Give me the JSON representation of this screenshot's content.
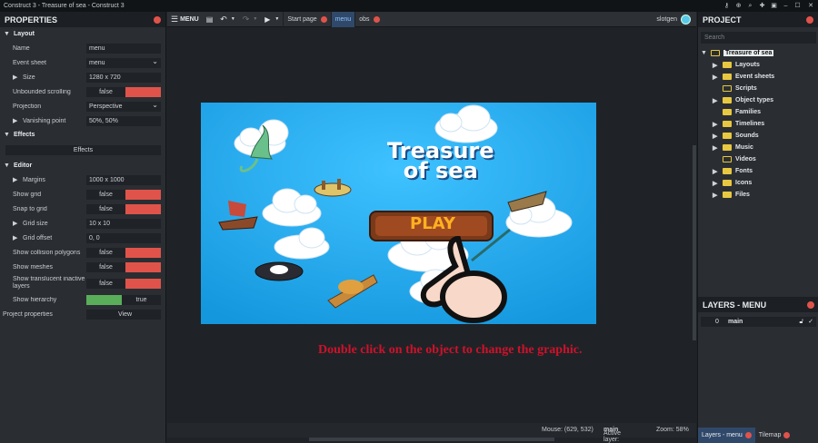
{
  "window": {
    "title": "Construct 3 - Treasure of sea - Construct 3"
  },
  "properties": {
    "title": "PROPERTIES",
    "sections": {
      "layout": "Layout",
      "effects": "Effects",
      "editor": "Editor"
    },
    "rows": {
      "name_label": "Name",
      "name_value": "menu",
      "eventsheet_label": "Event sheet",
      "eventsheet_value": "menu",
      "size_label": "Size",
      "size_value": "1280 x 720",
      "unbounded_label": "Unbounded scrolling",
      "unbounded_value": "false",
      "projection_label": "Projection",
      "projection_value": "Perspective",
      "vanishing_label": "Vanishing point",
      "vanishing_value": "50%, 50%",
      "effects_button": "Effects",
      "margins_label": "Margins",
      "margins_value": "1000 x 1000",
      "showgrid_label": "Show grid",
      "showgrid_value": "false",
      "snap_label": "Snap to grid",
      "snap_value": "false",
      "gridsize_label": "Grid size",
      "gridsize_value": "10 x 10",
      "gridoffset_label": "Grid offset",
      "gridoffset_value": "0, 0",
      "collision_label": "Show collision polygons",
      "collision_value": "false",
      "meshes_label": "Show meshes",
      "meshes_value": "false",
      "translucent_label": "Show translucent inactive layers",
      "translucent_value": "false",
      "hierarchy_label": "Show hierarchy",
      "hierarchy_value": "true",
      "project_label": "Project properties",
      "project_button": "View"
    }
  },
  "toolbar": {
    "menu_label": "MENU",
    "tabs": [
      {
        "label": "Start page"
      },
      {
        "label": "menu"
      },
      {
        "label": "obs"
      }
    ],
    "user": "slotgen"
  },
  "scene": {
    "title_line1": "Treasure",
    "title_line2": "of sea",
    "play_label": "PLAY"
  },
  "instruction": "Double click on the object to change the graphic.",
  "status": {
    "mouse": "Mouse: (629, 532)",
    "active_layer_label": "Active layer:",
    "active_layer_value": "main",
    "zoom": "Zoom: 58%"
  },
  "project": {
    "title": "PROJECT",
    "search_placeholder": "Search",
    "root": "Treasure of sea",
    "items": [
      "Layouts",
      "Event sheets",
      "Scripts",
      "Object types",
      "Families",
      "Timelines",
      "Sounds",
      "Music",
      "Videos",
      "Fonts",
      "Icons",
      "Files"
    ]
  },
  "layers": {
    "title": "LAYERS - MENU",
    "row_index": "0",
    "row_name": "main"
  },
  "bottom_tabs": {
    "layers": "Layers - menu",
    "tilemap": "Tilemap"
  },
  "colors": {
    "accent": "#e0534a",
    "sky": "#1fa6ea",
    "instruction": "#d0112b"
  }
}
